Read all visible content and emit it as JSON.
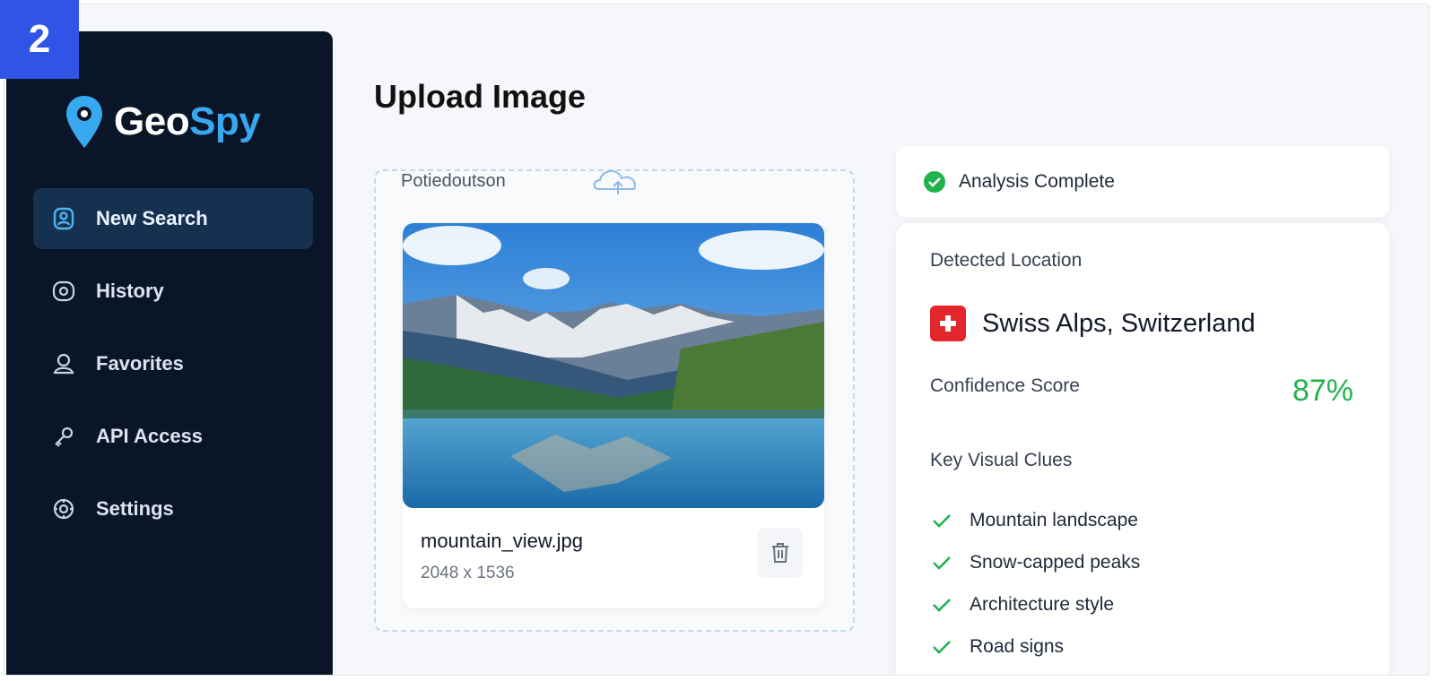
{
  "badge": "2",
  "brand": {
    "part1": "Geo",
    "part2": "Spy"
  },
  "sidebar": {
    "items": [
      {
        "label": "New Search",
        "icon": "user-search-icon",
        "active": true
      },
      {
        "label": "History",
        "icon": "history-icon",
        "active": false
      },
      {
        "label": "Favorites",
        "icon": "favorites-icon",
        "active": false
      },
      {
        "label": "API Access",
        "icon": "api-key-icon",
        "active": false
      },
      {
        "label": "Settings",
        "icon": "gear-icon",
        "active": false
      }
    ]
  },
  "main": {
    "title": "Upload Image",
    "upload": {
      "hint": "Potiedoutson",
      "file_name": "mountain_view.jpg",
      "file_dims": "2048 x 1536"
    }
  },
  "results": {
    "status": "Analysis Complete",
    "detected_label": "Detected Location",
    "location": "Swiss Alps, Switzerland",
    "confidence_label": "Confidence Score",
    "confidence_value": "87%",
    "clues_label": "Key Visual Clues",
    "clues": [
      "Mountain landscape",
      "Snow-capped peaks",
      "Architecture style",
      "Road signs"
    ]
  },
  "colors": {
    "sidebar_bg": "#0a1628",
    "accent": "#38a8f0",
    "badge": "#2f54e6",
    "success": "#22b24c",
    "flag": "#e3262b"
  }
}
